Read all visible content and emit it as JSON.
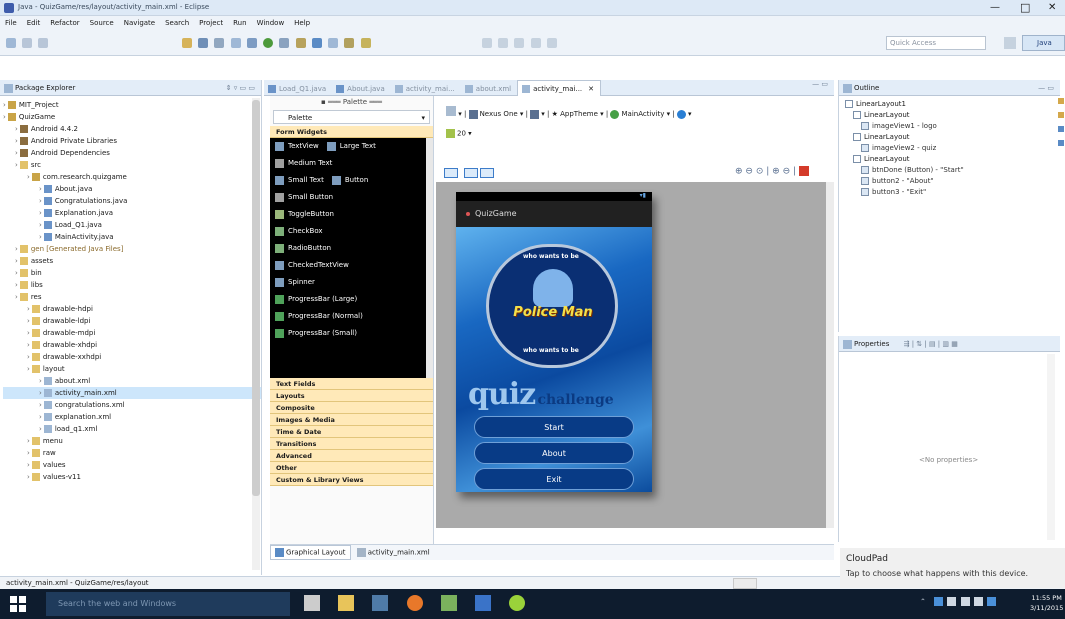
{
  "window": {
    "title": "Java - QuizGame/res/layout/activity_main.xml - Eclipse",
    "controls": [
      "—",
      "□",
      "✕"
    ]
  },
  "menu": [
    "File",
    "Edit",
    "Refactor",
    "Source",
    "Navigate",
    "Search",
    "Project",
    "Run",
    "Window",
    "Help"
  ],
  "toolbar": {
    "quick_access_placeholder": "Quick Access",
    "java_perspective": "Java"
  },
  "package_explorer": {
    "tab_label": "Package Explorer",
    "items": [
      {
        "label": "MIT_Project",
        "depth": 0,
        "icon": "project"
      },
      {
        "label": "QuizGame",
        "depth": 0,
        "icon": "project"
      },
      {
        "label": "Android 4.4.2",
        "depth": 1,
        "icon": "library"
      },
      {
        "label": "Android Private Libraries",
        "depth": 1,
        "icon": "library"
      },
      {
        "label": "Android Dependencies",
        "depth": 1,
        "icon": "library"
      },
      {
        "label": "src",
        "depth": 1,
        "icon": "folder"
      },
      {
        "label": "com.research.quizgame",
        "depth": 2,
        "icon": "package"
      },
      {
        "label": "About.java",
        "depth": 3,
        "icon": "java"
      },
      {
        "label": "Congratulations.java",
        "depth": 3,
        "icon": "java"
      },
      {
        "label": "Explanation.java",
        "depth": 3,
        "icon": "java"
      },
      {
        "label": "Load_Q1.java",
        "depth": 3,
        "icon": "java"
      },
      {
        "label": "MainActivity.java",
        "depth": 3,
        "icon": "java"
      },
      {
        "label": "gen [Generated Java Files]",
        "depth": 1,
        "icon": "folder"
      },
      {
        "label": "assets",
        "depth": 1,
        "icon": "folder"
      },
      {
        "label": "bin",
        "depth": 1,
        "icon": "folder"
      },
      {
        "label": "libs",
        "depth": 1,
        "icon": "folder"
      },
      {
        "label": "res",
        "depth": 1,
        "icon": "folder"
      },
      {
        "label": "drawable-hdpi",
        "depth": 2,
        "icon": "folder"
      },
      {
        "label": "drawable-ldpi",
        "depth": 2,
        "icon": "folder"
      },
      {
        "label": "drawable-mdpi",
        "depth": 2,
        "icon": "folder"
      },
      {
        "label": "drawable-xhdpi",
        "depth": 2,
        "icon": "folder"
      },
      {
        "label": "drawable-xxhdpi",
        "depth": 2,
        "icon": "folder"
      },
      {
        "label": "layout",
        "depth": 2,
        "icon": "folder"
      },
      {
        "label": "about.xml",
        "depth": 3,
        "icon": "xml"
      },
      {
        "label": "activity_main.xml",
        "depth": 3,
        "icon": "xml",
        "selected": true
      },
      {
        "label": "congratulations.xml",
        "depth": 3,
        "icon": "xml"
      },
      {
        "label": "explanation.xml",
        "depth": 3,
        "icon": "xml"
      },
      {
        "label": "load_q1.xml",
        "depth": 3,
        "icon": "xml"
      },
      {
        "label": "menu",
        "depth": 2,
        "icon": "folder"
      },
      {
        "label": "raw",
        "depth": 2,
        "icon": "folder"
      },
      {
        "label": "values",
        "depth": 2,
        "icon": "folder"
      },
      {
        "label": "values-v11",
        "depth": 2,
        "icon": "folder"
      }
    ]
  },
  "editor_tabs": [
    "Load_Q1.java",
    "About.java",
    "activity_mai...",
    "about.xml",
    "activity_mai..."
  ],
  "active_tab": "activity_mai...",
  "palette": {
    "header": "Palette",
    "dropdown": "Palette",
    "categories_top": [
      "Form Widgets"
    ],
    "widgets": [
      [
        "TextView",
        "Large Text"
      ],
      [
        "Medium Text"
      ],
      [
        "Small Text",
        "Button"
      ],
      [
        "Small Button"
      ],
      [
        "ToggleButton"
      ],
      [
        "CheckBox"
      ],
      [
        "RadioButton"
      ],
      [
        "CheckedTextView"
      ],
      [
        "Spinner"
      ],
      [
        "ProgressBar (Large)"
      ],
      [
        "ProgressBar (Normal)"
      ],
      [
        "ProgressBar (Small)"
      ]
    ],
    "categories": [
      "Text Fields",
      "Layouts",
      "Composite",
      "Images & Media",
      "Time & Date",
      "Transitions",
      "Advanced",
      "Other",
      "Custom & Library Views"
    ]
  },
  "layout_toolbar": {
    "device": "Nexus One",
    "theme": "AppTheme",
    "activity": "MainActivity",
    "api": "20"
  },
  "phone": {
    "app_title": "QuizGame",
    "logo_top": "who wants to be",
    "logo_main": "Police Man",
    "logo_bottom": "who wants to be",
    "quiz_big": "quiz",
    "quiz_small": "challenge",
    "buttons": [
      "Start",
      "About",
      "Exit"
    ]
  },
  "bottom_tabs": [
    "Graphical Layout",
    "activity_main.xml"
  ],
  "outline": {
    "tab_label": "Outline",
    "items": [
      {
        "label": "LinearLayout1",
        "depth": 0
      },
      {
        "label": "LinearLayout",
        "depth": 1
      },
      {
        "label": "imageView1 - logo",
        "depth": 2
      },
      {
        "label": "LinearLayout",
        "depth": 1
      },
      {
        "label": "imageView2 - quiz",
        "depth": 2
      },
      {
        "label": "LinearLayout",
        "depth": 1
      },
      {
        "label": "btnDone (Button) - \"Start\"",
        "depth": 2
      },
      {
        "label": "button2 - \"About\"",
        "depth": 2
      },
      {
        "label": "button3 - \"Exit\"",
        "depth": 2
      }
    ]
  },
  "properties": {
    "tab_label": "Properties",
    "empty": "<No properties>"
  },
  "status_bar": {
    "path": "activity_main.xml - QuizGame/res/layout"
  },
  "toast": {
    "title": "CloudPad",
    "body": "Tap to choose what happens with this device."
  },
  "taskbar": {
    "search_placeholder": "Search the web and Windows",
    "time": "11:55 PM",
    "date": "3/11/2015"
  },
  "colors": {
    "title_bar": "#dde9f6",
    "palette_header": "#ffe9b8",
    "phone_action_bar": "#212121",
    "phone_bg": "#0f58b0",
    "button_blue": "#083b86",
    "taskbar": "#0e1c2e"
  }
}
